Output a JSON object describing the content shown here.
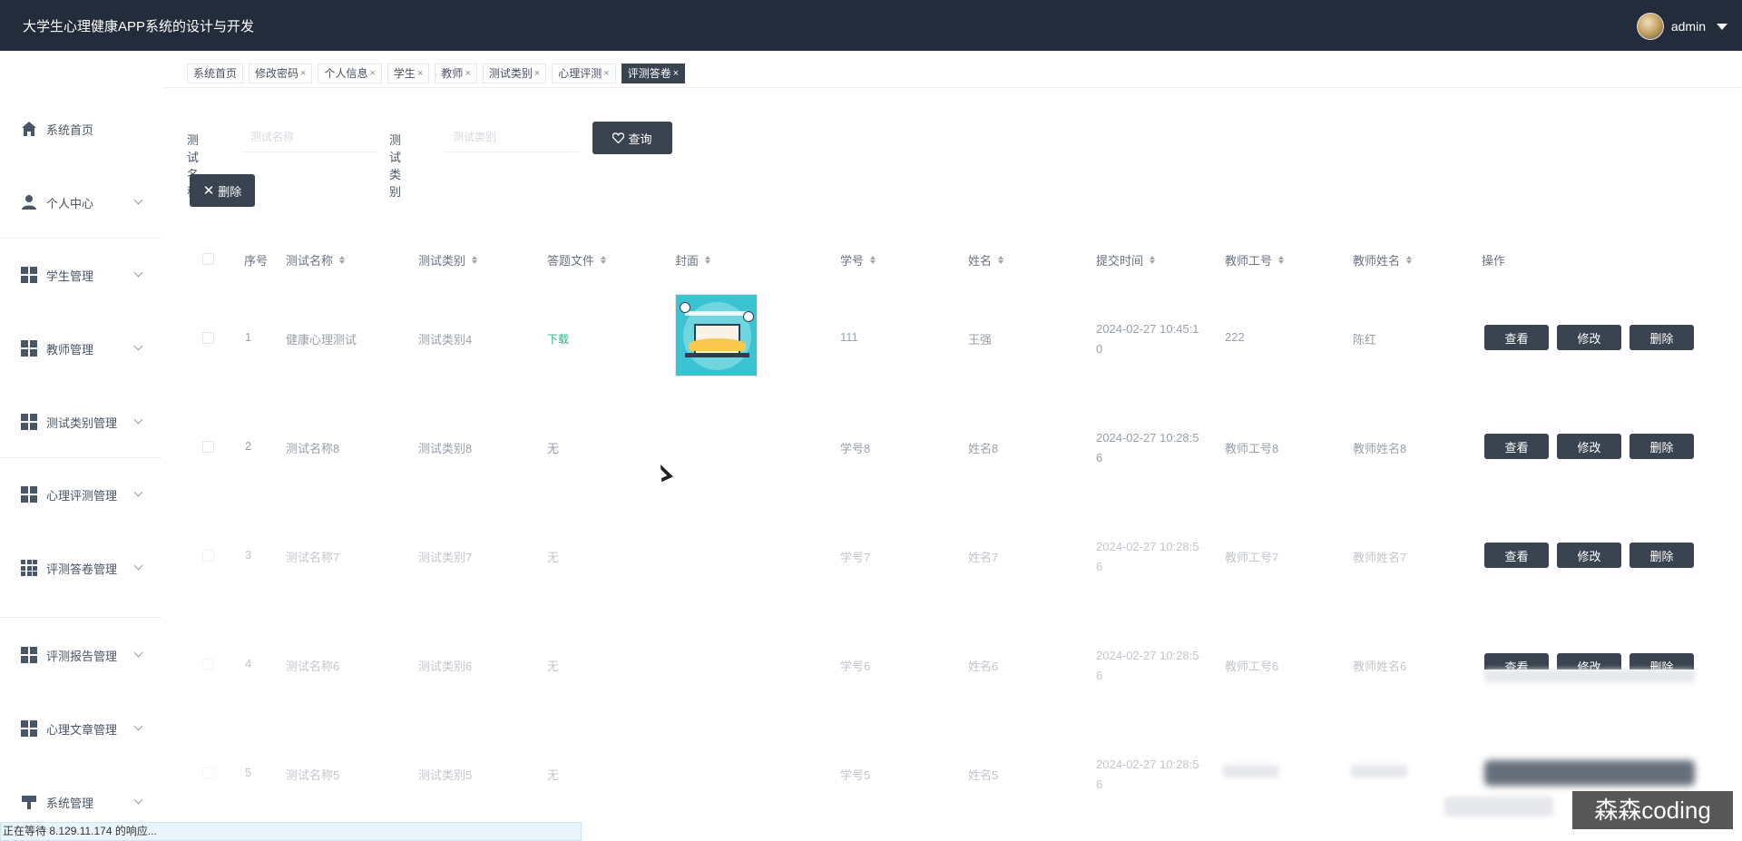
{
  "header": {
    "app_title": "大学生心理健康APP系统的设计与开发",
    "user_name": "admin"
  },
  "tabs": [
    {
      "label": "系统首页",
      "closable": false
    },
    {
      "label": "修改密码",
      "closable": true
    },
    {
      "label": "个人信息",
      "closable": true
    },
    {
      "label": "学生",
      "closable": true
    },
    {
      "label": "教师",
      "closable": true
    },
    {
      "label": "测试类别",
      "closable": true
    },
    {
      "label": "心理评测",
      "closable": true
    },
    {
      "label": "评测答卷",
      "closable": true,
      "active": true
    }
  ],
  "tab_close_glyph": "×",
  "sidebar": {
    "items": [
      {
        "label": "系统首页",
        "icon": "home-icon"
      },
      {
        "label": "个人中心",
        "icon": "user-icon"
      },
      {
        "label": "学生管理",
        "icon": "grid-icon"
      },
      {
        "label": "教师管理",
        "icon": "grid-icon"
      },
      {
        "label": "测试类别管理",
        "icon": "grid-icon"
      },
      {
        "label": "心理评测管理",
        "icon": "grid-icon"
      },
      {
        "label": "评测答卷管理",
        "icon": "apps-icon"
      },
      {
        "label": "评测报告管理",
        "icon": "grid-icon"
      },
      {
        "label": "心理文章管理",
        "icon": "grid-icon"
      },
      {
        "label": "系统管理",
        "icon": "brush-icon"
      }
    ]
  },
  "search": {
    "name_label": "测试名称",
    "name_placeholder": "测试名称",
    "type_label": "测试类别",
    "type_placeholder": "测试类别",
    "query_label": "查询",
    "query_icon": "heart-icon"
  },
  "toolbar": {
    "delete_label": "删除",
    "delete_icon": "close-icon"
  },
  "table": {
    "headers": [
      "序号",
      "测试名称",
      "测试类别",
      "答题文件",
      "封面",
      "学号",
      "姓名",
      "提交时间",
      "教师工号",
      "教师姓名",
      "操作"
    ],
    "action_labels": {
      "view": "查看",
      "edit": "修改",
      "delete": "删除"
    },
    "rows": [
      {
        "index": "1",
        "test_name": "健康心理测试",
        "test_type": "测试类别4",
        "answer_file": "下载",
        "has_cover": true,
        "student_id": "111",
        "name": "王强",
        "submit_time": "2024-02-27 10:45:10",
        "teacher_id": "222",
        "teacher_name": "陈红"
      },
      {
        "index": "2",
        "test_name": "测试名称8",
        "test_type": "测试类别8",
        "answer_file": "无",
        "has_cover": false,
        "student_id": "学号8",
        "name": "姓名8",
        "submit_time": "2024-02-27 10:28:56",
        "teacher_id": "教师工号8",
        "teacher_name": "教师姓名8"
      },
      {
        "index": "3",
        "test_name": "测试名称7",
        "test_type": "测试类别7",
        "answer_file": "无",
        "has_cover": false,
        "student_id": "学号7",
        "name": "姓名7",
        "submit_time": "2024-02-27 10:28:56",
        "teacher_id": "教师工号7",
        "teacher_name": "教师姓名7"
      },
      {
        "index": "4",
        "test_name": "测试名称6",
        "test_type": "测试类别6",
        "answer_file": "无",
        "has_cover": false,
        "student_id": "学号6",
        "name": "姓名6",
        "submit_time": "2024-02-27 10:28:56",
        "teacher_id": "教师工号6",
        "teacher_name": "教师姓名6"
      },
      {
        "index": "5",
        "test_name": "测试名称5",
        "test_type": "测试类别5",
        "answer_file": "无",
        "has_cover": false,
        "student_id": "学号5",
        "name": "姓名5",
        "submit_time": "2024-02-27 10:28:56",
        "teacher_id": "",
        "teacher_name": ""
      }
    ]
  },
  "status_bar": "正在等待 8.129.11.174 的响应...",
  "watermark": "森森coding",
  "colors": {
    "header_bg": "#232c3a",
    "button_bg": "#3a4350",
    "link_green": "#22b07d"
  }
}
